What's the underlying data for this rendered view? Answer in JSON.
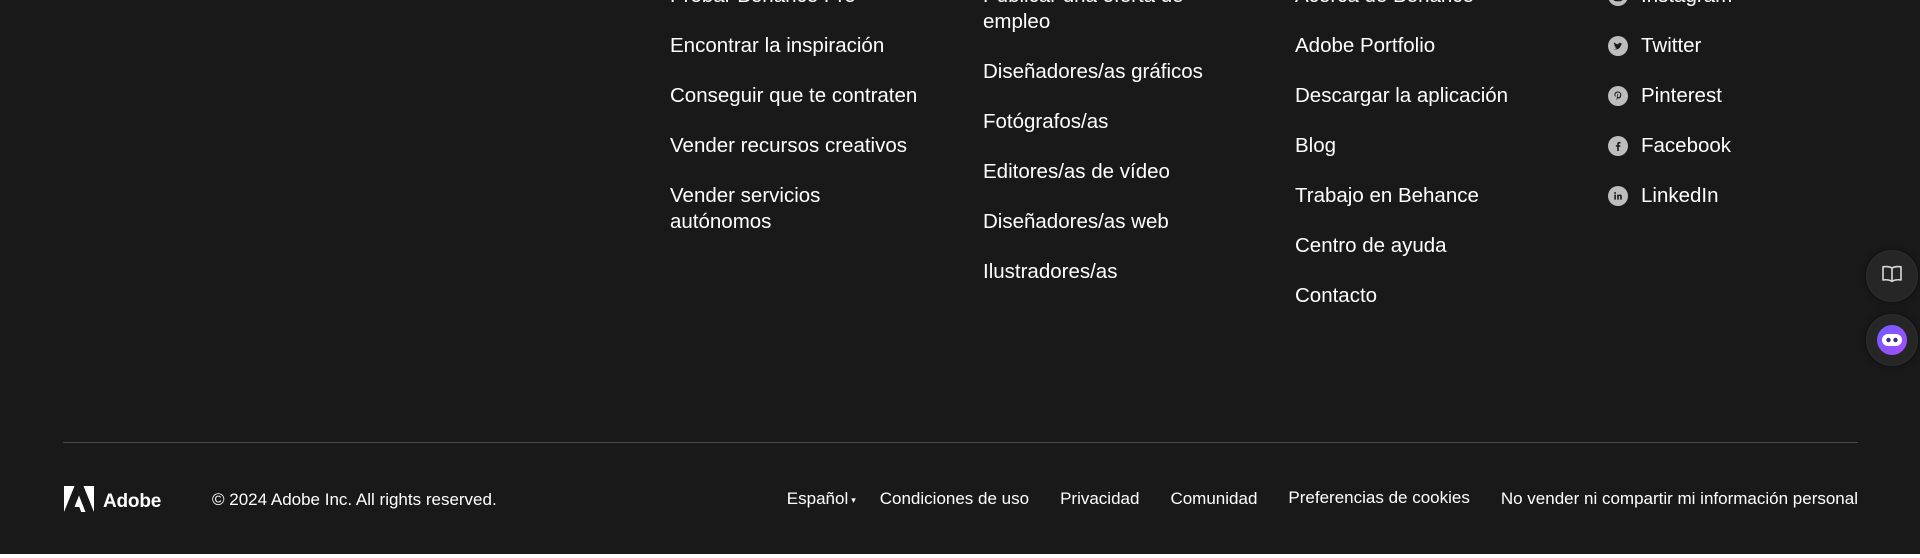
{
  "footer": {
    "columns": [
      {
        "links": [
          "Probar Behance Pro",
          "Encontrar la inspiración",
          "Conseguir que te contraten",
          "Vender recursos creativos",
          "Vender servicios autónomos"
        ]
      },
      {
        "links": [
          "Publicar una oferta de empleo",
          "Diseñadores/as gráficos",
          "Fotógrafos/as",
          "Editores/as de vídeo",
          "Diseñadores/as web",
          "Ilustradores/as"
        ]
      },
      {
        "links": [
          "Acerca de Behance",
          "Adobe Portfolio",
          "Descargar la aplicación",
          "Blog",
          "Trabajo en Behance",
          "Centro de ayuda",
          "Contacto"
        ]
      }
    ],
    "social": [
      {
        "label": "Instagram",
        "icon": "instagram-icon"
      },
      {
        "label": "Twitter",
        "icon": "twitter-icon"
      },
      {
        "label": "Pinterest",
        "icon": "pinterest-icon"
      },
      {
        "label": "Facebook",
        "icon": "facebook-icon"
      },
      {
        "label": "LinkedIn",
        "icon": "linkedin-icon"
      }
    ]
  },
  "bottom": {
    "brand": "Adobe",
    "copyright": "© 2024 Adobe Inc. All rights reserved.",
    "language": "Español",
    "legal_links": [
      "Condiciones de uso",
      "Privacidad",
      "Comunidad",
      "Preferencias de cookies",
      "No vender ni compartir mi información personal"
    ]
  },
  "side_buttons": {
    "book_icon": "book-icon",
    "assistant_icon": "assistant-icon"
  },
  "colors": {
    "background": "#191919",
    "text": "#ffffff",
    "divider": "#4a4a4a",
    "assistant_accent": "#7b5cff"
  }
}
